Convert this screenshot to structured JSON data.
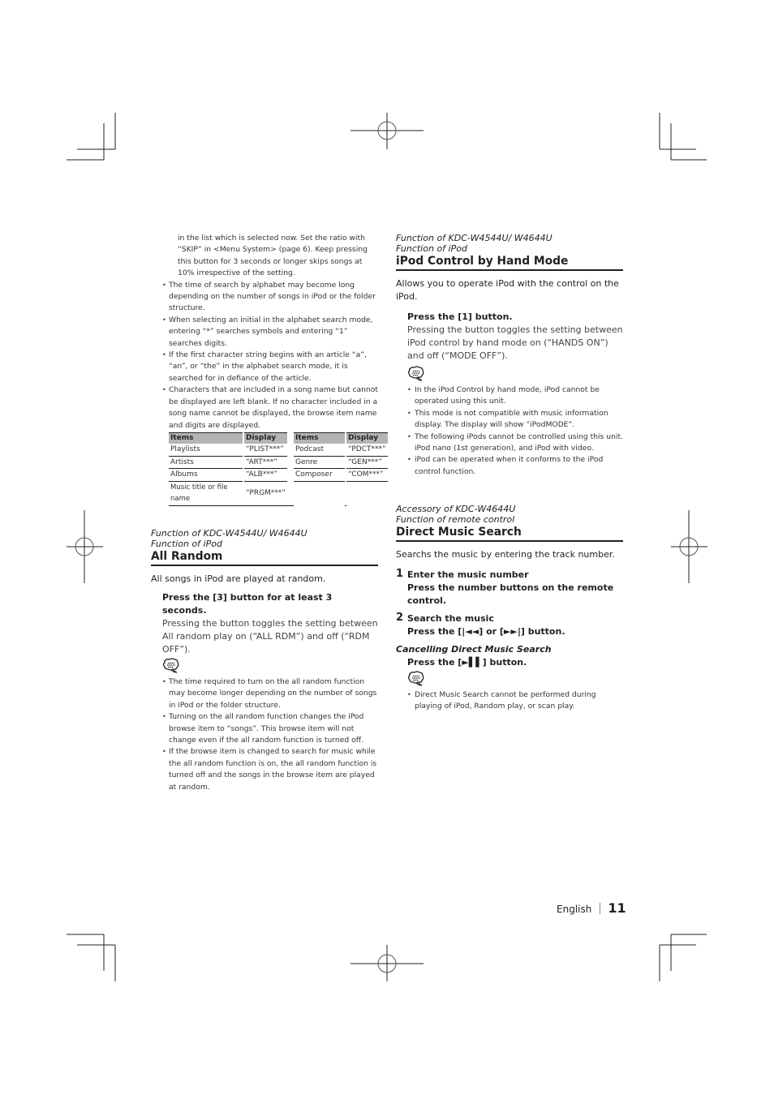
{
  "left_column": {
    "continuation_text": "in the list which is selected now. Set the ratio with “SKIP” in <Menu System> (page 6). Keep pressing this button for 3 seconds or longer skips songs at 10% irrespective of the setting.",
    "notes": [
      "The time of search by alphabet may become long depending on the number of songs in iPod or the folder structure.",
      "When selecting an initial in the alphabet search mode, entering “*” searches symbols and entering “1” searches digits.",
      "If the first character string begins with an article “a”, “an”, or “the” in the alphabet search mode, it is searched for in defiance of the article.",
      "Characters that are included in a song name but cannot be displayed are left blank. If no character included in a song name cannot be displayed, the browse item name and digits are displayed."
    ],
    "table": {
      "headers": [
        "Items",
        "Display",
        "Items",
        "Display"
      ],
      "rows": [
        [
          "Playlists",
          "“PLIST***”",
          "Podcast",
          "“PDCT***”"
        ],
        [
          "Artists",
          "“ART***”",
          "Genre",
          "“GEN***”"
        ],
        [
          "Albums",
          "“ALB***”",
          "Composer",
          "“COM***”"
        ],
        [
          "Music title or file name",
          "“PRGM***”",
          "",
          ""
        ]
      ]
    },
    "all_random": {
      "function_line1": "Function of KDC-W4544U/ W4644U",
      "function_line2": "Function of iPod",
      "title": "All Random",
      "intro": "All songs in iPod are played at random.",
      "step_title": "Press the [3] button for at least 3 seconds.",
      "step_desc": "Pressing the button toggles the setting between All random play  on (“ALL  RDM”) and off (“RDM OFF”).",
      "note_icon": "note-speech-bubble-icon",
      "notes": [
        "The time required to turn on the all random function may become longer depending on the number of songs in iPod or the folder structure.",
        "Turning on the all random function changes the iPod browse item to “songs”. This browse item will not change even if the all random function is turned off.",
        "If the browse item is changed to search for music while the all random function is on,  the all random function is turned off and the songs in the browse item are played at random."
      ]
    }
  },
  "right_column": {
    "hand_mode": {
      "function_line1": "Function of KDC-W4544U/ W4644U",
      "function_line2": "Function of iPod",
      "title": "iPod Control by Hand Mode",
      "intro": "Allows you to operate iPod with the control on the iPod.",
      "step_title": "Press the [1] button.",
      "step_desc": "Pressing the button toggles the setting between iPod control by hand mode on (“HANDS ON”) and off (“MODE OFF”).",
      "note_icon": "note-speech-bubble-icon",
      "notes": [
        "In the iPod Control by hand mode, iPod cannot be operated using this unit.",
        "This mode is not compatible with music information display. The display will show “iPodMODE”.",
        "The following iPods cannot be controlled using this unit. iPod nano (1st generation), and iPod with video.",
        "iPod can be operated when it conforms to the iPod control function."
      ]
    },
    "direct_search": {
      "function_line1": "Accessory of KDC-W4644U",
      "function_line2": "Function of remote control",
      "title": "Direct Music Search",
      "intro": "Searchs the music by entering the track number.",
      "steps": [
        {
          "number": "1",
          "title": "Enter the music number",
          "desc": "Press the number buttons on the remote control."
        },
        {
          "number": "2",
          "title": "Search the music",
          "desc": "Press the [|◄◄] or [►►|] button."
        }
      ],
      "cancel_title": "Cancelling Direct Music Search",
      "cancel_desc": "Press the [►▌▌] button.",
      "note_icon": "note-speech-bubble-icon",
      "notes": [
        "Direct Music Search cannot be performed during playing of iPod, Random play, or scan play."
      ]
    }
  },
  "footer": {
    "language": "English",
    "page_number": "11"
  }
}
